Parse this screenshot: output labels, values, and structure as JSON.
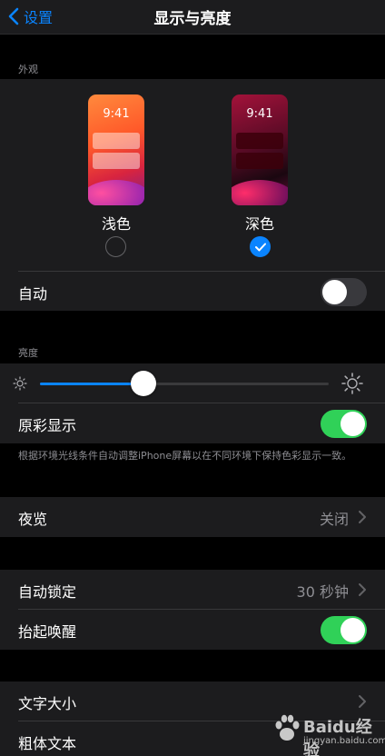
{
  "nav": {
    "back_label": "设置",
    "title": "显示与亮度"
  },
  "appearance": {
    "header": "外观",
    "light": {
      "time": "9:41",
      "label": "浅色",
      "selected": false
    },
    "dark": {
      "time": "9:41",
      "label": "深色",
      "selected": true
    },
    "auto_label": "自动",
    "auto_on": false
  },
  "brightness": {
    "header": "亮度",
    "level": 0.36,
    "true_tone_label": "原彩显示",
    "true_tone_on": true,
    "true_tone_footnote": "根据环境光线条件自动调整iPhone屏幕以在不同环境下保持色彩显示一致。"
  },
  "night_shift": {
    "label": "夜览",
    "value": "关闭"
  },
  "lock": {
    "auto_lock_label": "自动锁定",
    "auto_lock_value": "30 秒钟",
    "raise_to_wake_label": "抬起唤醒",
    "raise_to_wake_on": true
  },
  "text": {
    "text_size_label": "文字大小",
    "bold_text_label": "粗体文本"
  },
  "watermark": {
    "text": "Baidu经验",
    "sub": "jingyan.baidu.com"
  },
  "colors": {
    "accent": "#0a84ff",
    "toggle_on": "#30d158",
    "background": "#000000",
    "cell": "#1c1c1e"
  }
}
